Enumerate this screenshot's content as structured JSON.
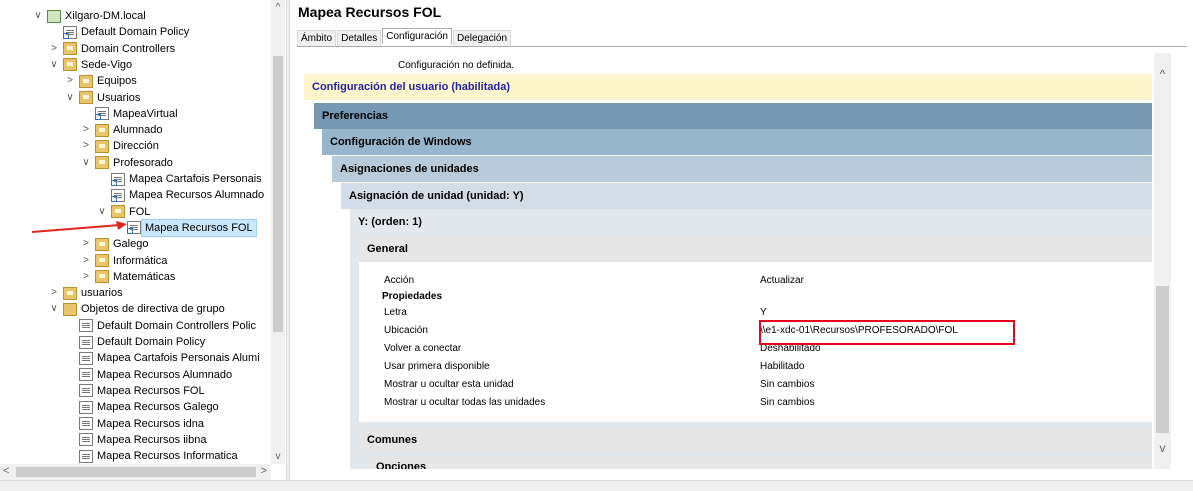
{
  "tree": {
    "nodes": [
      {
        "label": "Xilgaro-DM.local",
        "expander": "∨",
        "icon": "domain-icon"
      },
      {
        "label": "Default Domain Policy",
        "expander": "",
        "icon": "gpo-link-icon"
      },
      {
        "label": "Domain Controllers",
        "expander": ">",
        "icon": "folder-icon"
      },
      {
        "label": "Sede-Vigo",
        "expander": "∨",
        "icon": "folder-icon"
      },
      {
        "label": "Equipos",
        "expander": ">",
        "icon": "folder-icon"
      },
      {
        "label": "Usuarios",
        "expander": "∨",
        "icon": "folder-icon"
      },
      {
        "label": "MapeaVirtual",
        "expander": "",
        "icon": "gpo-link-icon"
      },
      {
        "label": "Alumnado",
        "expander": ">",
        "icon": "folder-icon"
      },
      {
        "label": "Dirección",
        "expander": ">",
        "icon": "folder-icon"
      },
      {
        "label": "Profesorado",
        "expander": "∨",
        "icon": "folder-icon"
      },
      {
        "label": "Mapea Cartafois Personais",
        "expander": "",
        "icon": "gpo-link-icon"
      },
      {
        "label": "Mapea Recursos Alumnado",
        "expander": "",
        "icon": "gpo-link-icon"
      },
      {
        "label": "FOL",
        "expander": "∨",
        "icon": "folder-icon"
      },
      {
        "label": "Mapea Recursos FOL",
        "expander": "",
        "icon": "gpo-link-icon",
        "selected": true
      },
      {
        "label": "Galego",
        "expander": ">",
        "icon": "folder-icon"
      },
      {
        "label": "Informática",
        "expander": ">",
        "icon": "folder-icon"
      },
      {
        "label": "Matemáticas",
        "expander": ">",
        "icon": "folder-icon"
      },
      {
        "label": "usuarios",
        "expander": ">",
        "icon": "folder-icon"
      },
      {
        "label": "Objetos de directiva de grupo",
        "expander": "∨",
        "icon": "gpo-folder-icon"
      },
      {
        "label": "Default Domain Controllers Polic",
        "expander": "",
        "icon": "gpo-icon"
      },
      {
        "label": "Default Domain Policy",
        "expander": "",
        "icon": "gpo-icon"
      },
      {
        "label": "Mapea Cartafois Personais Alumi",
        "expander": "",
        "icon": "gpo-icon"
      },
      {
        "label": "Mapea Recursos Alumnado",
        "expander": "",
        "icon": "gpo-icon"
      },
      {
        "label": "Mapea Recursos FOL",
        "expander": "",
        "icon": "gpo-icon"
      },
      {
        "label": "Mapea Recursos Galego",
        "expander": "",
        "icon": "gpo-icon"
      },
      {
        "label": "Mapea Recursos idna",
        "expander": "",
        "icon": "gpo-icon"
      },
      {
        "label": "Mapea Recursos iibna",
        "expander": "",
        "icon": "gpo-icon"
      },
      {
        "label": "Mapea Recursos Informatica",
        "expander": "",
        "icon": "gpo-icon"
      }
    ]
  },
  "details": {
    "title": "Mapea Recursos FOL",
    "tabs": [
      "Ámbito",
      "Detalles",
      "Configuración",
      "Delegación"
    ],
    "active_tab": "Configuración",
    "not_defined": "Configuración no definida.",
    "user_config": "Configuración del usuario (habilitada)",
    "preferences": "Preferencias",
    "windows_config": "Configuración de Windows",
    "drive_maps": "Asignaciones de unidades",
    "drive_map": "Asignación de unidad (unidad: Y)",
    "order": "Y: (orden: 1)",
    "general": "General",
    "action_label": "Acción",
    "action_value": "Actualizar",
    "properties_heading": "Propiedades",
    "properties": [
      {
        "label": "Letra",
        "value": "Y"
      },
      {
        "label": "Ubicación",
        "value": "\\\\e1-xdc-01\\Recursos\\PROFESORADO\\FOL"
      },
      {
        "label": "Volver a conectar",
        "value": "Deshabilitado"
      },
      {
        "label": "Usar primera disponible",
        "value": "Habilitado"
      },
      {
        "label": "Mostrar u ocultar esta unidad",
        "value": "Sin cambios"
      },
      {
        "label": "Mostrar u ocultar todas las unidades",
        "value": "Sin cambios"
      }
    ],
    "common": "Comunes",
    "options": "Opciones"
  },
  "colors": {
    "user_config_bg": "#fdf6cc",
    "preferences_bg": "#7599b3",
    "windows_config_bg": "#97b5cb",
    "drive_maps_bg": "#b7cbda",
    "drive_map_bg": "#d3dde7",
    "order_bg": "#e3e8ed",
    "general_bg": "#e6e6e6",
    "highlight": "#e8001c",
    "arrow": "#e0261c"
  }
}
